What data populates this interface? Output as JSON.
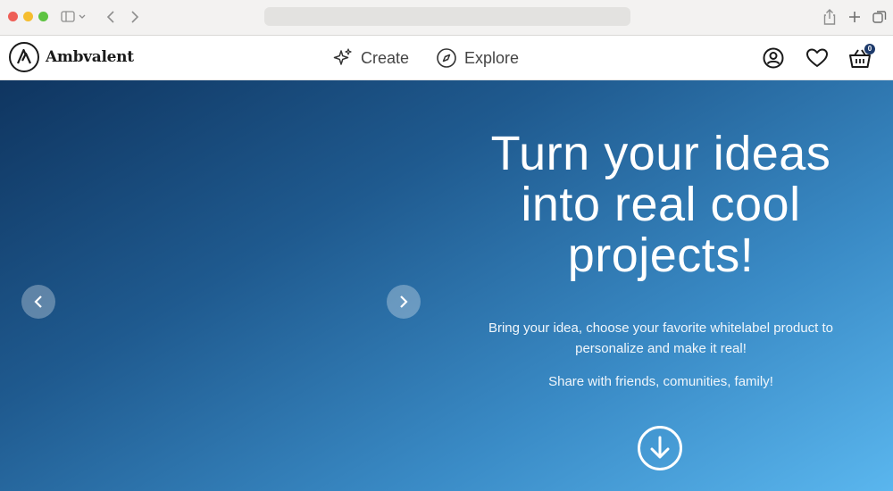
{
  "browser": {
    "address": "",
    "icons": [
      "sidebar-toggle-icon",
      "chevron-left-icon",
      "chevron-right-icon",
      "share-icon",
      "plus-icon",
      "tabs-icon"
    ]
  },
  "header": {
    "brand": "Ambvalent",
    "nav": [
      {
        "label": "Create",
        "icon": "sparkle-icon"
      },
      {
        "label": "Explore",
        "icon": "compass-icon"
      }
    ],
    "cart_count": "0"
  },
  "hero": {
    "title": "Turn your ideas into real cool projects!",
    "subtitle": "Bring your idea, choose your favorite whitelabel product to personalize and make it real!",
    "share_text": "Share with friends, comunities, family!"
  },
  "colors": {
    "gradient_start": "#0f3560",
    "gradient_end": "#5ab6ee",
    "text_light": "#ffffff"
  }
}
